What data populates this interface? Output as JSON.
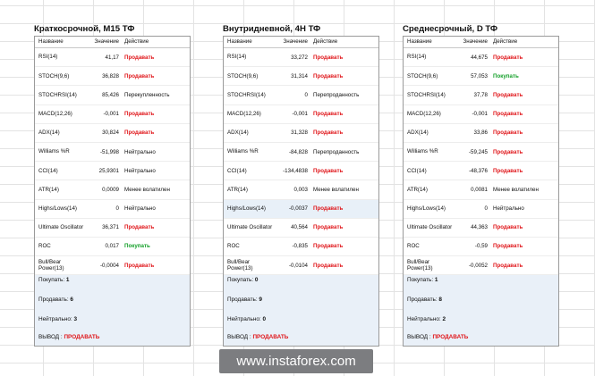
{
  "header": {
    "name": "Название",
    "value": "Значение",
    "action": "Действие"
  },
  "colors": {
    "sell": "#e0161a",
    "buy": "#15a02a",
    "summary_bg": "#e9f0f8"
  },
  "panels": [
    {
      "title": "Краткосрочной, M15 ТФ",
      "rows": [
        {
          "name": "RSI(14)",
          "value": "41,17",
          "action": "Продавать",
          "type": "sell"
        },
        {
          "name": "STOCH(9,6)",
          "value": "36,828",
          "action": "Продавать",
          "type": "sell"
        },
        {
          "name": "STOCHRSI(14)",
          "value": "85,426",
          "action": "Перекупленность",
          "type": "neutral"
        },
        {
          "name": "MACD(12,26)",
          "value": "-0,001",
          "action": "Продавать",
          "type": "sell"
        },
        {
          "name": "ADX(14)",
          "value": "30,824",
          "action": "Продавать",
          "type": "sell"
        },
        {
          "name": "Williams %R",
          "value": "-51,998",
          "action": "Нейтрально",
          "type": "neutral"
        },
        {
          "name": "CCI(14)",
          "value": "25,9301",
          "action": "Нейтрально",
          "type": "neutral"
        },
        {
          "name": "ATR(14)",
          "value": "0,0009",
          "action": "Менее волатилен",
          "type": "neutral"
        },
        {
          "name": "Highs/Lows(14)",
          "value": "0",
          "action": "Нейтрально",
          "type": "neutral"
        },
        {
          "name": "Ultimate Oscillator",
          "value": "36,371",
          "action": "Продавать",
          "type": "sell"
        },
        {
          "name": "ROC",
          "value": "0,017",
          "action": "Покупать",
          "type": "buy"
        },
        {
          "name": "Bull/Bear Power(13)",
          "value": "-0,0004",
          "action": "Продавать",
          "type": "sell"
        }
      ],
      "summary": {
        "buy_label": "Покупать:",
        "buy": "1",
        "sell_label": "Продавать:",
        "sell": "6",
        "neutral_label": "Нейтрально:",
        "neutral": "3",
        "verdict_label": "ВЫВОД :",
        "verdict": "ПРОДАВАТЬ"
      }
    },
    {
      "title": "Внутридневной, 4H ТФ",
      "rows": [
        {
          "name": "RSI(14)",
          "value": "33,272",
          "action": "Продавать",
          "type": "sell"
        },
        {
          "name": "STOCH(9,6)",
          "value": "31,314",
          "action": "Продавать",
          "type": "sell"
        },
        {
          "name": "STOCHRSI(14)",
          "value": "0",
          "action": "Перепроданность",
          "type": "neutral"
        },
        {
          "name": "MACD(12,26)",
          "value": "-0,001",
          "action": "Продавать",
          "type": "sell"
        },
        {
          "name": "ADX(14)",
          "value": "31,328",
          "action": "Продавать",
          "type": "sell"
        },
        {
          "name": "Williams %R",
          "value": "-84,828",
          "action": "Перепроданность",
          "type": "neutral"
        },
        {
          "name": "CCI(14)",
          "value": "-134,4838",
          "action": "Продавать",
          "type": "sell"
        },
        {
          "name": "ATR(14)",
          "value": "0,003",
          "action": "Менее волатилен",
          "type": "neutral"
        },
        {
          "name": "Highs/Lows(14)",
          "value": "-0,0037",
          "action": "Продавать",
          "type": "sell",
          "highlight": true
        },
        {
          "name": "Ultimate Oscillator",
          "value": "40,564",
          "action": "Продавать",
          "type": "sell"
        },
        {
          "name": "ROC",
          "value": "-0,835",
          "action": "Продавать",
          "type": "sell"
        },
        {
          "name": "Bull/Bear Power(13)",
          "value": "-0,0104",
          "action": "Продавать",
          "type": "sell"
        }
      ],
      "summary": {
        "buy_label": "Покупать:",
        "buy": "0",
        "sell_label": "Продавать:",
        "sell": "9",
        "neutral_label": "Нейтрально:",
        "neutral": "0",
        "verdict_label": "ВЫВОД :",
        "verdict": "ПРОДАВАТЬ"
      }
    },
    {
      "title": "Среднесрочный, D ТФ",
      "rows": [
        {
          "name": "RSI(14)",
          "value": "44,675",
          "action": "Продавать",
          "type": "sell"
        },
        {
          "name": "STOCH(9,6)",
          "value": "57,053",
          "action": "Покупать",
          "type": "buy"
        },
        {
          "name": "STOCHRSI(14)",
          "value": "37,78",
          "action": "Продавать",
          "type": "sell"
        },
        {
          "name": "MACD(12,26)",
          "value": "-0,001",
          "action": "Продавать",
          "type": "sell"
        },
        {
          "name": "ADX(14)",
          "value": "33,86",
          "action": "Продавать",
          "type": "sell"
        },
        {
          "name": "Williams %R",
          "value": "-59,245",
          "action": "Продавать",
          "type": "sell"
        },
        {
          "name": "CCI(14)",
          "value": "-48,376",
          "action": "Продавать",
          "type": "sell"
        },
        {
          "name": "ATR(14)",
          "value": "0,0081",
          "action": "Менее волатилен",
          "type": "neutral"
        },
        {
          "name": "Highs/Lows(14)",
          "value": "0",
          "action": "Нейтрально",
          "type": "neutral"
        },
        {
          "name": "Ultimate Oscillator",
          "value": "44,363",
          "action": "Продавать",
          "type": "sell"
        },
        {
          "name": "ROC",
          "value": "-0,59",
          "action": "Продавать",
          "type": "sell"
        },
        {
          "name": "Bull/Bear Power(13)",
          "value": "-0,0052",
          "action": "Продавать",
          "type": "sell"
        }
      ],
      "summary": {
        "buy_label": "Покупать:",
        "buy": "1",
        "sell_label": "Продавать:",
        "sell": "8",
        "neutral_label": "Нейтрально:",
        "neutral": "2",
        "verdict_label": "ВЫВОД :",
        "verdict": "ПРОДАВАТЬ"
      }
    }
  ],
  "watermark": "www.instaforex.com"
}
